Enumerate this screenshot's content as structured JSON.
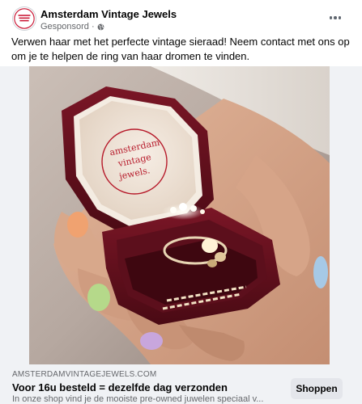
{
  "post": {
    "page_name": "Amsterdam Vintage Jewels",
    "sponsored_label": "Gesponsord",
    "separator": "·",
    "caption": "Verwen haar met het perfecte vintage sieraad! Neem contact met ons op om je te helpen de ring van haar dromen te vinden."
  },
  "avatar": {
    "logo_text": "amsterdam vintage jewels."
  },
  "media": {
    "box_imprint": "amsterdam vintage jewels."
  },
  "link": {
    "domain": "AMSTERDAMVINTAGEJEWELS.COM",
    "headline": "Voor 16u besteld = dezelfde dag verzonden",
    "description": "In onze shop vind je de mooiste pre-owned juwelen speciaal v...",
    "cta_label": "Shoppen"
  },
  "colors": {
    "text_primary": "#050505",
    "text_secondary": "#65676b",
    "link_bar_bg": "#f0f2f5",
    "button_bg": "#e4e6eb",
    "logo_red": "#c8102e"
  },
  "icons": {
    "globe": "globe-icon",
    "more": "more-horizontal-icon"
  }
}
